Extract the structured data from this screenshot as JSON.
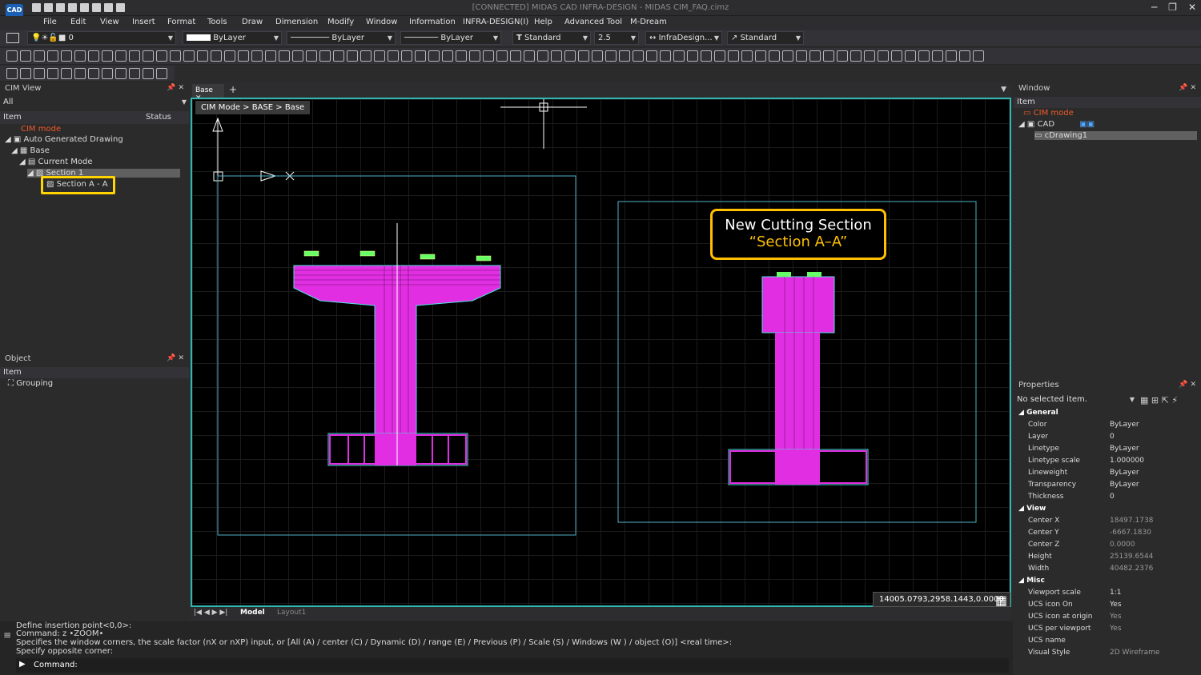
{
  "app": {
    "logo_text": "CAD",
    "title": "[CONNECTED] MIDAS CAD INFRA-DESIGN - MIDAS CIM_FAQ.cimz"
  },
  "menu": [
    "File",
    "Edit",
    "View",
    "Insert",
    "Format",
    "Tools",
    "Draw",
    "Dimension",
    "Modify",
    "Window",
    "Information",
    "INFRA-DESIGN(I)",
    "Help",
    "Advanced Tool",
    "M-Dream"
  ],
  "toolbar": {
    "layer": "0",
    "color": "ByLayer",
    "linetype": "ByLayer",
    "lineweight": "ByLayer",
    "textstyle": "Standard",
    "textheight": "2.5",
    "dimstyle": "InfraDesign...",
    "multileader": "Standard"
  },
  "cim_view": {
    "title": "CIM View",
    "filter": "All",
    "col_item": "Item",
    "col_status": "Status",
    "tree": [
      "CIM mode",
      "Auto Generated Drawing",
      "Base",
      "Current Mode",
      "Section 1",
      "Section A - A"
    ]
  },
  "object_panel": {
    "title": "Object",
    "col_item": "Item",
    "item": "Grouping"
  },
  "window_panel": {
    "title": "Window",
    "col_item": "Item",
    "tree": [
      "CIM mode",
      "CAD",
      "cDrawing1"
    ]
  },
  "properties": {
    "title": "Properties",
    "selection": "No selected item.",
    "sections": [
      {
        "name": "General",
        "rows": [
          [
            "Color",
            "ByLayer"
          ],
          [
            "Layer",
            "0"
          ],
          [
            "Linetype",
            "ByLayer"
          ],
          [
            "Linetype scale",
            "1.000000"
          ],
          [
            "Lineweight",
            "ByLayer"
          ],
          [
            "Transparency",
            "ByLayer"
          ],
          [
            "Thickness",
            "0"
          ]
        ]
      },
      {
        "name": "View",
        "rows": [
          [
            "Center X",
            "18497.1738"
          ],
          [
            "Center Y",
            "-6667.1830"
          ],
          [
            "Center Z",
            "0.0000"
          ],
          [
            "Height",
            "25139.6544"
          ],
          [
            "Width",
            "40482.2376"
          ]
        ]
      },
      {
        "name": "Misc",
        "rows": [
          [
            "Viewport scale",
            "1:1"
          ],
          [
            "UCS icon On",
            "Yes"
          ],
          [
            "UCS icon at origin",
            "Yes"
          ],
          [
            "UCS per viewport",
            "Yes"
          ],
          [
            "UCS name",
            ""
          ],
          [
            "Visual Style",
            "2D Wireframe"
          ]
        ]
      }
    ]
  },
  "document": {
    "tab": "Base",
    "breadcrumb": "CIM Mode > BASE > Base",
    "coords": "14005.0793,2958.1443,0.0000"
  },
  "callout": {
    "line1": "New Cutting Section",
    "line2": "“Section A–A”"
  },
  "layout_tabs": {
    "model": "Model",
    "layout1": "Layout1"
  },
  "command": {
    "lines": [
      "Define insertion point<0,0>:",
      "Command: z •ZOOM•",
      "Specifies the window corners, the scale factor (nX or nXP) input, or [All (A) / center (C) / Dynamic (D) / range (E) / Previous (P) / Scale (S) / Windows (W ) / object (O)] <real time>:",
      "Specify opposite corner:"
    ],
    "prompt": "Command:"
  }
}
